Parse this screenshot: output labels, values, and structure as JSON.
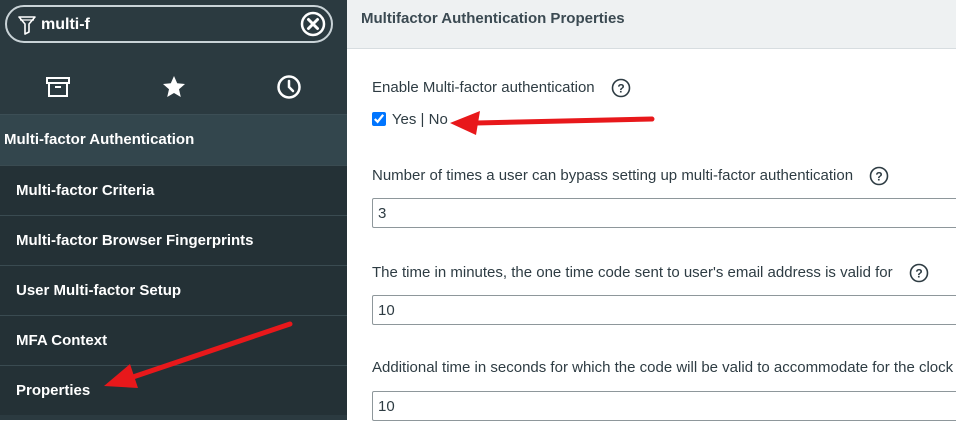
{
  "sidebar": {
    "filter": {
      "value": "multi-f"
    },
    "tabs": [
      {
        "icon": "archive-icon"
      },
      {
        "icon": "star-icon"
      },
      {
        "icon": "clock-icon"
      }
    ],
    "section": "Multi-factor Authentication",
    "items": [
      {
        "label": "Multi-factor Criteria"
      },
      {
        "label": "Multi-factor Browser Fingerprints"
      },
      {
        "label": "User Multi-factor Setup"
      },
      {
        "label": "MFA Context"
      },
      {
        "label": "Properties"
      }
    ]
  },
  "main": {
    "title": "Multifactor Authentication Properties",
    "fields": [
      {
        "label": "Enable Multi-factor authentication",
        "yes_label": "Yes | No",
        "checked": true
      },
      {
        "label": "Number of times a user can bypass setting up multi-factor authentication",
        "value": "3"
      },
      {
        "label": "The time in minutes, the one time code sent to user's email address is valid for",
        "value": "10"
      },
      {
        "label": "Additional time in seconds for which the code will be valid to accommodate for the clock",
        "value": "10"
      }
    ]
  },
  "colors": {
    "sidebar_bg": "#2b3a40",
    "nav_item_bg": "#243136",
    "annotation_arrow": "#e8181b"
  }
}
